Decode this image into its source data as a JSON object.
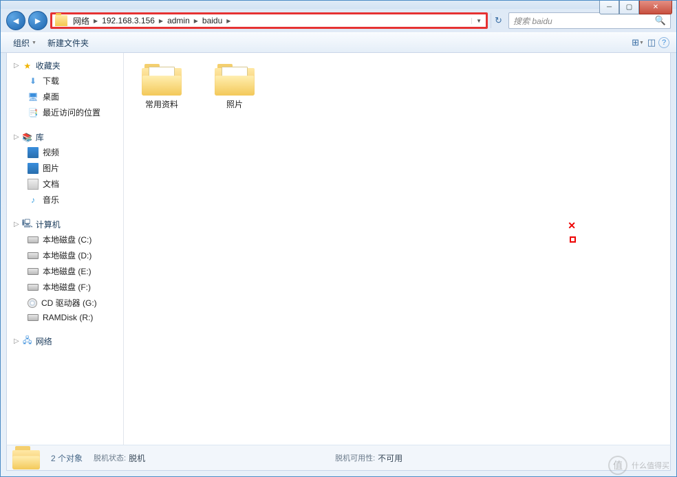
{
  "breadcrumb": [
    "网络",
    "192.168.3.156",
    "admin",
    "baidu"
  ],
  "search": {
    "placeholder": "搜索 baidu"
  },
  "toolbar": {
    "organize": "组织",
    "newfolder": "新建文件夹"
  },
  "sidebar": {
    "favorites": {
      "label": "收藏夹",
      "items": [
        "下载",
        "桌面",
        "最近访问的位置"
      ]
    },
    "libraries": {
      "label": "库",
      "items": [
        "视频",
        "图片",
        "文档",
        "音乐"
      ]
    },
    "computer": {
      "label": "计算机",
      "items": [
        "本地磁盘 (C:)",
        "本地磁盘 (D:)",
        "本地磁盘 (E:)",
        "本地磁盘 (F:)",
        "CD 驱动器 (G:)",
        "RAMDisk (R:)"
      ]
    },
    "network": {
      "label": "网络"
    }
  },
  "folders": [
    {
      "name": "常用资料"
    },
    {
      "name": "照片"
    }
  ],
  "status": {
    "count": "2 个对象",
    "offline_status_label": "脱机状态:",
    "offline_status_value": "脱机",
    "offline_avail_label": "脱机可用性:",
    "offline_avail_value": "不可用"
  },
  "watermark": "什么值得买"
}
